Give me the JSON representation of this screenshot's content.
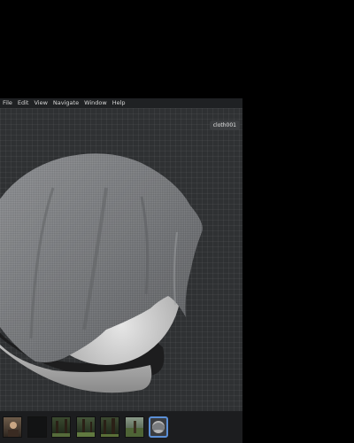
{
  "menu": [
    {
      "label": "File",
      "name": "menu-file"
    },
    {
      "label": "Edit",
      "name": "menu-edit"
    },
    {
      "label": "View",
      "name": "menu-view"
    },
    {
      "label": "Navigate",
      "name": "menu-navigate"
    },
    {
      "label": "Window",
      "name": "menu-window"
    },
    {
      "label": "Help",
      "name": "menu-help"
    }
  ],
  "viewport": {
    "object_label": "cloth001"
  },
  "thumbnails": [
    {
      "icon": "portrait-scene-thumbnail",
      "selected": false
    },
    {
      "icon": "dark-scene-thumbnail",
      "selected": false
    },
    {
      "icon": "forest-scene-thumbnail",
      "selected": false
    },
    {
      "icon": "forest-scene-thumbnail",
      "selected": false
    },
    {
      "icon": "forest-scene-thumbnail",
      "selected": false
    },
    {
      "icon": "outdoor-scene-thumbnail",
      "selected": false
    },
    {
      "icon": "cloth-preview-thumbnail",
      "selected": true
    }
  ],
  "colors": {
    "selection_accent": "#5b8fd6",
    "viewport_bg": "#2f3133",
    "menubar_bg": "#1f2123"
  }
}
